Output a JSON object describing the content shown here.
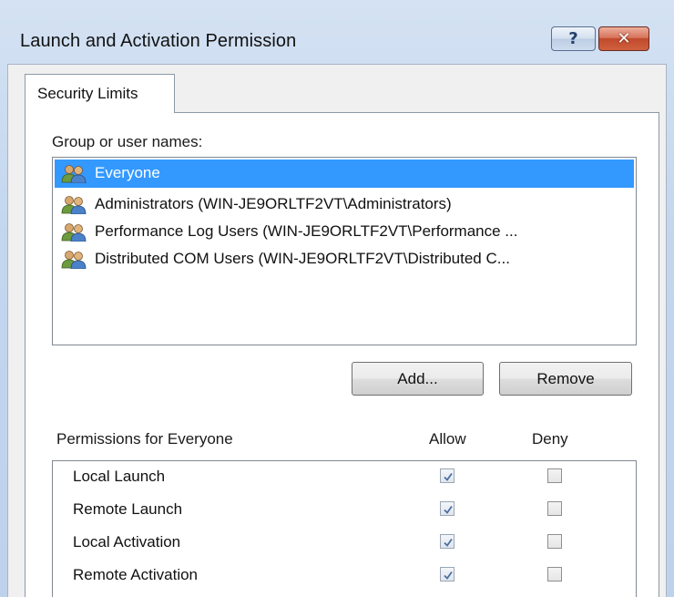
{
  "window": {
    "title": "Launch and Activation Permission",
    "help_glyph": "?",
    "close_glyph": "✕"
  },
  "tab": {
    "label": "Security Limits"
  },
  "group_section": {
    "label": "Group or user names:",
    "items": [
      {
        "label": "Everyone",
        "icon": "users-group-icon",
        "selected": true
      },
      {
        "label": "Administrators (WIN-JE9ORLTF2VT\\Administrators)",
        "icon": "users-group-icon",
        "selected": false
      },
      {
        "label": "Performance Log Users (WIN-JE9ORLTF2VT\\Performance ...",
        "icon": "users-group-icon",
        "selected": false
      },
      {
        "label": "Distributed COM Users (WIN-JE9ORLTF2VT\\Distributed C...",
        "icon": "users-group-icon",
        "selected": false
      }
    ]
  },
  "buttons": {
    "add": "Add...",
    "remove": "Remove"
  },
  "permissions": {
    "header": "Permissions for Everyone",
    "allow_header": "Allow",
    "deny_header": "Deny",
    "rows": [
      {
        "name": "Local Launch",
        "allow": true,
        "deny": false
      },
      {
        "name": "Remote Launch",
        "allow": true,
        "deny": false
      },
      {
        "name": "Local Activation",
        "allow": true,
        "deny": false
      },
      {
        "name": "Remote Activation",
        "allow": true,
        "deny": false
      }
    ]
  },
  "colors": {
    "selection": "#3399ff",
    "titlebar": "#c3d6ee",
    "close_button": "#c04a2c"
  }
}
